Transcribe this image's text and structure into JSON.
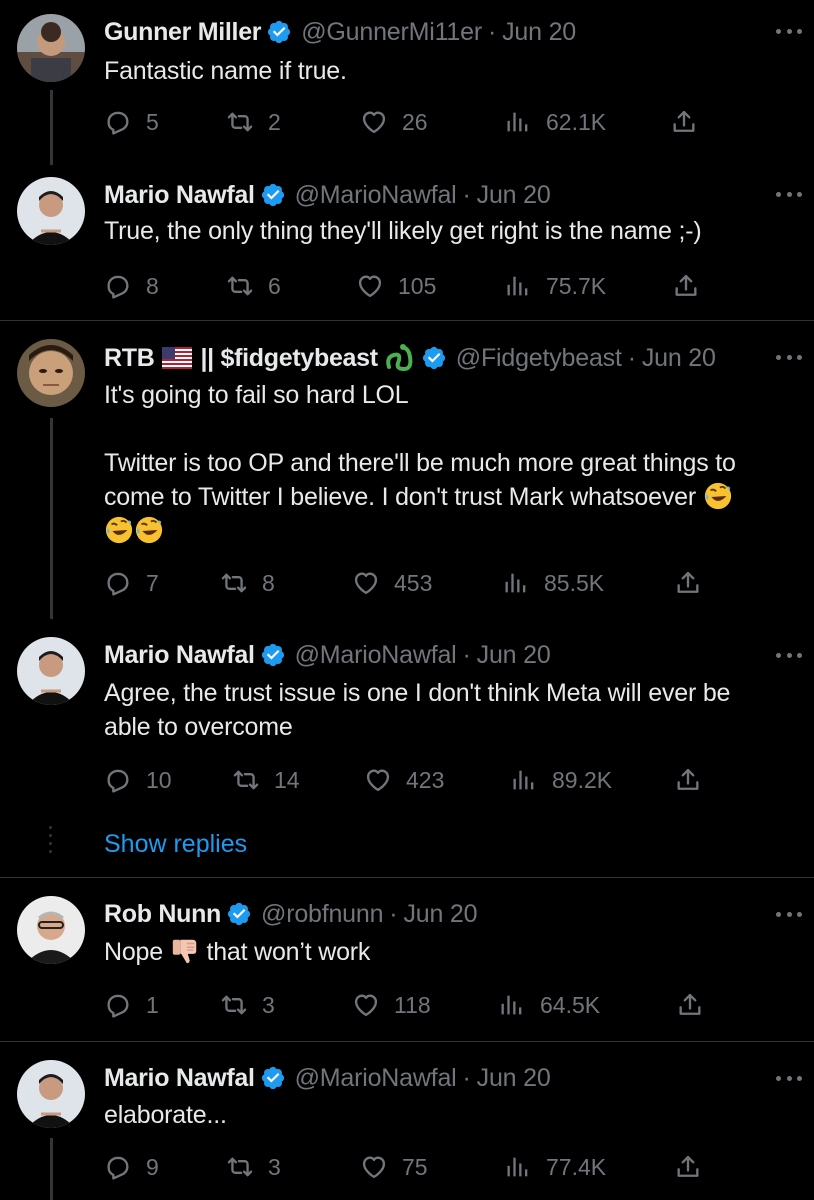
{
  "tweets": [
    {
      "name": "Gunner Miller",
      "handle": "@GunnerMi11er",
      "date": "Jun 20",
      "text": "Fantastic name if true.",
      "replies": "5",
      "retweets": "2",
      "likes": "26",
      "views": "62.1K"
    },
    {
      "name": "Mario Nawfal",
      "handle": "@MarioNawfal",
      "date": "Jun 20",
      "text": "True, the only thing they'll likely get right is the name ;-)",
      "replies": "8",
      "retweets": "6",
      "likes": "105",
      "views": "75.7K"
    },
    {
      "name": "RTB",
      "name_suffix": "|| $fidgetybeast",
      "handle": "@Fidgetybeast",
      "date": "Jun 20",
      "text_line1": "It's going to fail so hard LOL",
      "text_line2": "Twitter is too OP and there'll be much more great things to",
      "text_line3": "come to Twitter I believe. I don't trust Mark whatsoever",
      "replies": "7",
      "retweets": "8",
      "likes": "453",
      "views": "85.5K"
    },
    {
      "name": "Mario Nawfal",
      "handle": "@MarioNawfal",
      "date": "Jun 20",
      "text_line1": "Agree, the trust issue is one I don't think Meta will ever be",
      "text_line2": "able to overcome",
      "replies": "10",
      "retweets": "14",
      "likes": "423",
      "views": "89.2K"
    },
    {
      "name": "Rob Nunn",
      "handle": "@robfnunn",
      "date": "Jun 20",
      "text_before": "Nope",
      "text_after": "that won’t work",
      "replies": "1",
      "retweets": "3",
      "likes": "118",
      "views": "64.5K"
    },
    {
      "name": "Mario Nawfal",
      "handle": "@MarioNawfal",
      "date": "Jun 20",
      "text": "elaborate...",
      "replies": "9",
      "retweets": "3",
      "likes": "75",
      "views": "77.4K"
    }
  ],
  "show_replies": "Show replies",
  "separator": "·",
  "colors": {
    "background": "#000000",
    "text": "#e7e9ea",
    "muted": "#71767b",
    "accent": "#1d9bf0",
    "verified": "#1d9bf0"
  },
  "icons": [
    "verified-badge-icon",
    "reply-icon",
    "retweet-icon",
    "like-icon",
    "views-icon",
    "share-icon",
    "more-icon",
    "flag-us-icon",
    "snake-emoji-icon",
    "rofl-emoji-icon",
    "thumbs-down-emoji-icon"
  ]
}
